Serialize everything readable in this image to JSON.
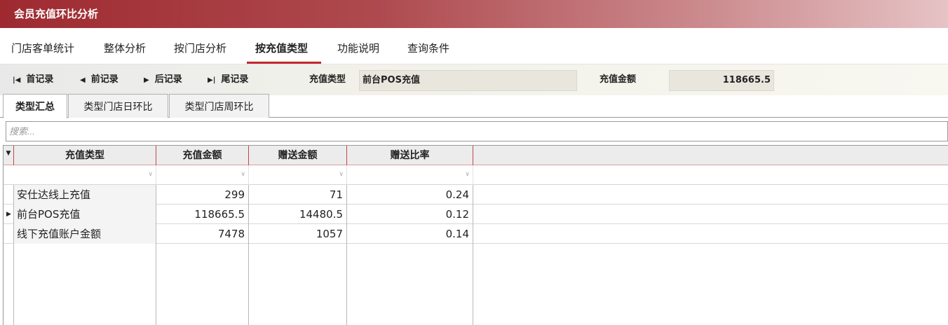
{
  "window": {
    "title": "会员充值环比分析"
  },
  "main_tabs": [
    {
      "label": "门店客单统计"
    },
    {
      "label": "整体分析"
    },
    {
      "label": "按门店分析"
    },
    {
      "label": "按充值类型",
      "active": true
    },
    {
      "label": "功能说明"
    },
    {
      "label": "查询条件"
    }
  ],
  "record_nav": {
    "first": {
      "label": "首记录",
      "icon": "first-record-icon"
    },
    "prev": {
      "label": "前记录",
      "icon": "prev-record-icon"
    },
    "next": {
      "label": "后记录",
      "icon": "next-record-icon"
    },
    "last": {
      "label": "尾记录",
      "icon": "last-record-icon"
    }
  },
  "fields": {
    "type_label": "充值类型",
    "type_value": "前台POS充值",
    "amount_label": "充值金额",
    "amount_value": "118665.5"
  },
  "sub_tabs": [
    {
      "label": "类型汇总",
      "active": true
    },
    {
      "label": "类型门店日环比"
    },
    {
      "label": "类型门店周环比"
    }
  ],
  "search": {
    "placeholder": "搜索..."
  },
  "table": {
    "columns": [
      "充值类型",
      "充值金额",
      "赠送金额",
      "赠送比率"
    ],
    "rows": [
      {
        "type": "安仕达线上充值",
        "amount": "299",
        "bonus": "71",
        "ratio": "0.24",
        "current": false
      },
      {
        "type": "前台POS充值",
        "amount": "118665.5",
        "bonus": "14480.5",
        "ratio": "0.12",
        "current": true
      },
      {
        "type": "线下充值账户金额",
        "amount": "7478",
        "bonus": "1057",
        "ratio": "0.14",
        "current": false
      }
    ]
  },
  "colors": {
    "titlebar": "#9e2a30",
    "accent": "#c0282d"
  }
}
